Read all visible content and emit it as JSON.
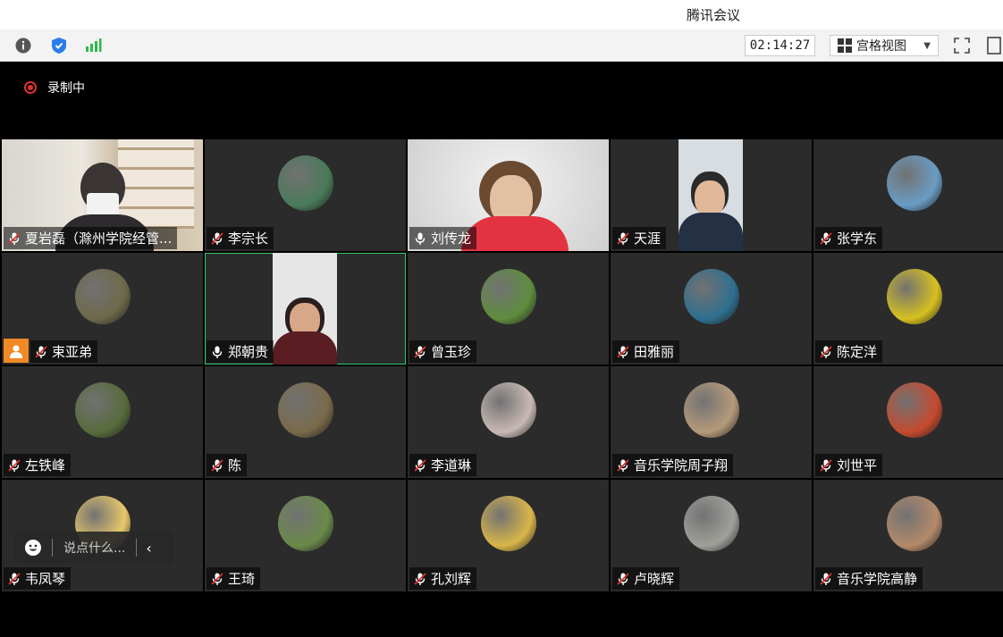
{
  "window": {
    "title": "腾讯会议"
  },
  "toolbar": {
    "info_icon": "info-icon",
    "shield_icon": "shield-icon",
    "signal_icon": "signal-icon",
    "timer": "02:14:27",
    "view_label": "宫格视图",
    "fullscreen_icon": "fullscreen-icon",
    "window_icon": "window-icon"
  },
  "recording": {
    "label": "录制中"
  },
  "participants": [
    {
      "name": "夏岩磊（滁州学院经管...",
      "mic": "muted",
      "kind": "video"
    },
    {
      "name": "李宗长",
      "mic": "muted",
      "kind": "avatar",
      "color": "#4a7a5a"
    },
    {
      "name": "刘传龙",
      "mic": "on",
      "kind": "video"
    },
    {
      "name": "天涯",
      "mic": "muted",
      "kind": "video"
    },
    {
      "name": "张学东",
      "mic": "muted",
      "kind": "avatar",
      "color": "#6a9cc4"
    },
    {
      "name": "束亚弟",
      "mic": "muted",
      "kind": "avatar",
      "color": "#6d6a4a",
      "host": true
    },
    {
      "name": "郑朝贵",
      "mic": "on",
      "kind": "video",
      "active": true
    },
    {
      "name": "曾玉珍",
      "mic": "muted",
      "kind": "avatar",
      "color": "#5f8c3e"
    },
    {
      "name": "田雅丽",
      "mic": "muted",
      "kind": "avatar",
      "color": "#2f6f8f"
    },
    {
      "name": "陈定洋",
      "mic": "muted",
      "kind": "avatar",
      "color": "#d6c020"
    },
    {
      "name": "左铁峰",
      "mic": "muted",
      "kind": "avatar",
      "color": "#586b3c"
    },
    {
      "name": "陈",
      "mic": "muted",
      "kind": "avatar",
      "color": "#7a6a4a"
    },
    {
      "name": "李道琳",
      "mic": "muted",
      "kind": "avatar",
      "color": "#c8b9b4"
    },
    {
      "name": "音乐学院周子翔",
      "mic": "muted",
      "kind": "avatar",
      "color": "#b59a7a"
    },
    {
      "name": "刘世平",
      "mic": "muted",
      "kind": "avatar",
      "color": "#c54a2f"
    },
    {
      "name": "韦凤琴",
      "mic": "muted",
      "kind": "avatar",
      "color": "#e8c86a"
    },
    {
      "name": "王琦",
      "mic": "muted",
      "kind": "avatar",
      "color": "#6a8a4a"
    },
    {
      "name": "孔刘辉",
      "mic": "muted",
      "kind": "avatar",
      "color": "#d8b64a"
    },
    {
      "name": "卢晓辉",
      "mic": "muted",
      "kind": "avatar",
      "color": "#a0a09a"
    },
    {
      "name": "音乐学院高静",
      "mic": "muted",
      "kind": "avatar",
      "color": "#b48a6a"
    }
  ],
  "chat": {
    "placeholder": "说点什么...",
    "emoji_icon": "emoji-icon",
    "collapse_icon": "chevron-left-icon"
  }
}
